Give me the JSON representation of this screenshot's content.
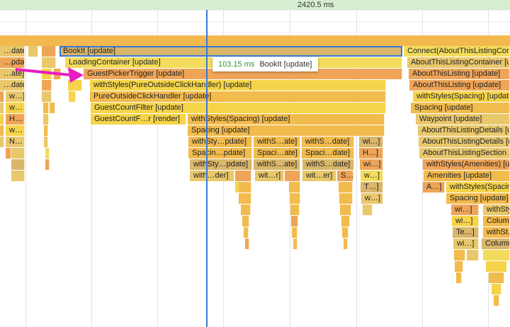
{
  "ruler": {
    "time_label": "2420.5 ms"
  },
  "tooltip": {
    "duration": "103.15 ms",
    "name": "BookIt [update]"
  },
  "colors": {
    "selection": "#3a78d6",
    "annotation_arrow": "#e81cc0",
    "tooltip_time": "#2a9a2a"
  },
  "flame": {
    "labels": [
      "…date]",
      "BookIt [update]",
      "Connect(AboutThisListingContainer)",
      "…pdate]",
      "LoadingContainer [update]",
      "AboutThisListingContainer [update]",
      "…ate]",
      "GuestPickerTrigger [update]",
      "AboutThisListing [update]",
      "…date]",
      "withStyles(PureOutsideClickHandler) [update]",
      "AboutThisListing [update]",
      "w…]",
      "PureOutsideClickHandler [update]",
      "withStyles(Spacing) [update]",
      "w…",
      "GuestCountFilter [update]",
      "Spacing [update]",
      "H…",
      "GuestCountF…r [render]",
      "withStyles(Spacing) [update]",
      "Waypoint [update]",
      "w…",
      "Spacing [update]",
      "AboutThisListingDetails [update]",
      "N…",
      "withSty…pdate]",
      "withS…ate]",
      "withS…date]",
      "wi…]",
      "AboutThisListingDetails [update]",
      "Spacin…pdate]",
      "Spaci…ate]",
      "Spaci…date]",
      "H…]",
      "AboutThisListingSection [update]",
      "withSty…pdate]",
      "withS…ate]",
      "withS…date]",
      "wi…]",
      "withStyles(Amenities) [update]",
      "with…der]",
      "wit…r]",
      "wit…er]",
      "S…",
      "w…]",
      "Amenities [update]",
      "T…]",
      "A…]",
      "withStyles(Spacing)",
      "w…]",
      "Spacing [update]",
      "wi…]",
      "withStyles",
      "wi…]",
      "Column",
      "Te…]",
      "withSt.",
      "wi…]",
      "Column"
    ]
  }
}
